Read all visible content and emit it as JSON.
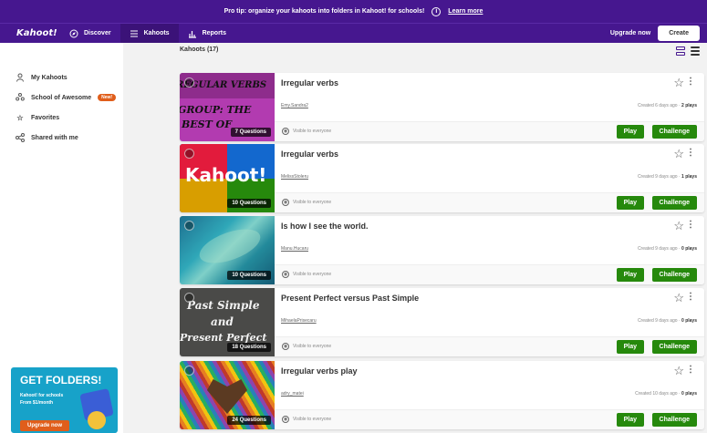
{
  "promo_bar": {
    "text": "Pro tip: organize your kahoots into folders in Kahoot! for schools!",
    "info_glyph": "i",
    "link": "Learn more"
  },
  "nav": {
    "logo": "Kahoot!",
    "items": [
      {
        "label": "Discover",
        "icon": "compass-icon"
      },
      {
        "label": "Kahoots",
        "icon": "list-icon"
      },
      {
        "label": "Reports",
        "icon": "bar-chart-icon"
      }
    ],
    "upgrade": "Upgrade now",
    "create": "Create"
  },
  "sidebar": {
    "items": [
      {
        "label": "My Kahoots",
        "icon": "person-icon"
      },
      {
        "label": "School of Awesome",
        "icon": "group-icon",
        "badge": "New!"
      },
      {
        "label": "Favorites",
        "icon": "star-icon"
      },
      {
        "label": "Shared with me",
        "icon": "share-icon"
      }
    ],
    "promo": {
      "title": "GET FOLDERS!",
      "subtitle": "Kahoot! for schools From $1/month",
      "button": "Upgrade now"
    }
  },
  "list": {
    "title": "Kahoots (17)"
  },
  "kahoots": [
    {
      "title": "Irregular verbs",
      "author": "Emy.Sandra2",
      "created": "Created 6 days ago · ",
      "plays": "2 plays",
      "questions": "7 Questions",
      "visibility": "Visible to everyone",
      "thumb_lines": [
        "REGULAR VERBS",
        "GROUP: THE",
        "BEST OF"
      ]
    },
    {
      "title": "Irregular verbs",
      "author": "MelissStoleru",
      "created": "Created 9 days ago · ",
      "plays": "1 plays",
      "questions": "10 Questions",
      "visibility": "Visible to everyone",
      "thumb_lines": [
        "Kahoot!"
      ]
    },
    {
      "title": "Is how I see the world.",
      "author": "Manu.Hucaru",
      "created": "Created 9 days ago · ",
      "plays": "0 plays",
      "questions": "10 Questions",
      "visibility": "Visible to everyone",
      "thumb_lines": []
    },
    {
      "title": "Present Perfect versus Past Simple",
      "author": "MihaelaPrisecaru",
      "created": "Created 9 days ago · ",
      "plays": "0 plays",
      "questions": "18 Questions",
      "visibility": "Visible to everyone",
      "thumb_lines": [
        "Past Simple",
        "and",
        "Present Perfect"
      ]
    },
    {
      "title": "Irregular verbs play",
      "author": "adry_matei",
      "created": "Created 10 days ago · ",
      "plays": "0 plays",
      "questions": "24 Questions",
      "visibility": "Visible to everyone",
      "thumb_lines": []
    }
  ],
  "buttons": {
    "play": "Play",
    "challenge": "Challenge"
  },
  "colors": {
    "brand_purple": "#46178f",
    "play_green": "#26890c",
    "badge_orange": "#e05e1b"
  }
}
